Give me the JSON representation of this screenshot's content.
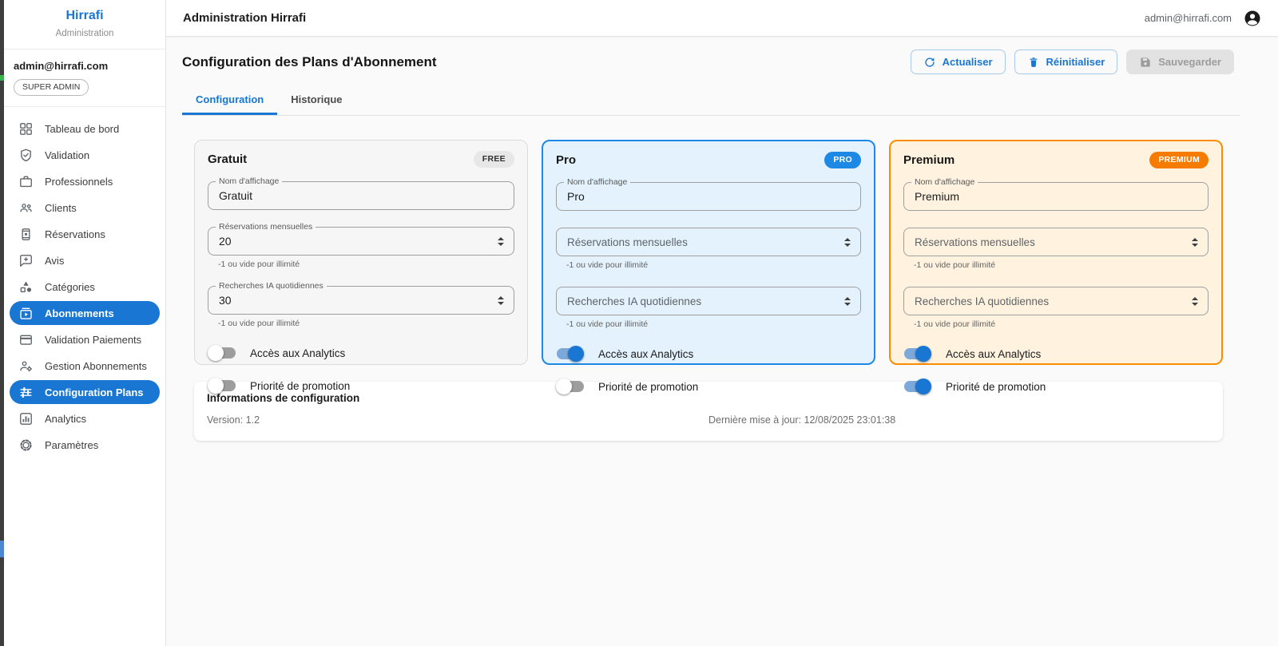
{
  "colors": {
    "accent": "#1976d2",
    "free_card_bg": "#f6f6f6",
    "free_card_border": "#dbdbdb",
    "free_badge_bg": "#e7e7e7",
    "free_badge_text": "#2f2f2f",
    "pro_card_bg": "#e3f2fd",
    "pro_card_border": "#1e88e5",
    "pro_badge_bg": "#1e88e5",
    "pro_badge_text": "#ffffff",
    "premium_card_bg": "#fff3e0",
    "premium_card_border": "#fb8c00",
    "premium_badge_bg": "#f57c00",
    "premium_badge_text": "#ffffff"
  },
  "sidebar": {
    "brand_title": "Hirrafi",
    "brand_subtitle": "Administration",
    "user_email": "admin@hirrafi.com",
    "user_role": "SUPER ADMIN",
    "items": [
      {
        "label": "Tableau de bord",
        "icon": "dashboard-icon",
        "selected": false
      },
      {
        "label": "Validation",
        "icon": "shield-check-icon",
        "selected": false
      },
      {
        "label": "Professionnels",
        "icon": "briefcase-icon",
        "selected": false
      },
      {
        "label": "Clients",
        "icon": "people-icon",
        "selected": false
      },
      {
        "label": "Réservations",
        "icon": "reservations-icon",
        "selected": false
      },
      {
        "label": "Avis",
        "icon": "review-icon",
        "selected": false
      },
      {
        "label": "Catégories",
        "icon": "categories-icon",
        "selected": false
      },
      {
        "label": "Abonnements",
        "icon": "subscriptions-icon",
        "selected": true
      },
      {
        "label": "Validation Paiements",
        "icon": "credit-card-icon",
        "selected": false
      },
      {
        "label": "Gestion Abonnements",
        "icon": "user-gear-icon",
        "selected": false
      },
      {
        "label": "Configuration Plans",
        "icon": "tune-icon",
        "selected": true
      },
      {
        "label": "Analytics",
        "icon": "analytics-icon",
        "selected": false
      },
      {
        "label": "Paramètres",
        "icon": "gear-icon",
        "selected": false
      }
    ]
  },
  "topbar": {
    "title": "Administration Hirrafi",
    "user_email": "admin@hirrafi.com"
  },
  "page": {
    "title": "Configuration des Plans d'Abonnement",
    "buttons": [
      {
        "name": "refresh",
        "label": "Actualiser",
        "icon": "refresh-icon",
        "style": "outlined"
      },
      {
        "name": "reset",
        "label": "Réinitialiser",
        "icon": "trash-icon",
        "style": "outlined"
      },
      {
        "name": "save",
        "label": "Sauvegarder",
        "icon": "save-icon",
        "style": "disabled"
      }
    ],
    "tabs": [
      {
        "label": "Configuration",
        "active": true
      },
      {
        "label": "Historique",
        "active": false
      }
    ]
  },
  "plan_fields": {
    "name_label": "Nom d'affichage",
    "reservations_label": "Réservations mensuelles",
    "searches_label": "Recherches IA quotidiennes",
    "unlimited_hint": "-1 ou vide pour illimité",
    "analytics_label": "Accès aux Analytics",
    "promotion_label": "Priorité de promotion"
  },
  "plans": [
    {
      "key": "free",
      "title": "Gratuit",
      "badge": "FREE",
      "name_value": "Gratuit",
      "reservations_value": "20",
      "searches_value": "30",
      "analytics_on": false,
      "promotion_on": false
    },
    {
      "key": "pro",
      "title": "Pro",
      "badge": "PRO",
      "name_value": "Pro",
      "reservations_value": "",
      "searches_value": "",
      "analytics_on": true,
      "promotion_on": false
    },
    {
      "key": "premium",
      "title": "Premium",
      "badge": "PREMIUM",
      "name_value": "Premium",
      "reservations_value": "",
      "searches_value": "",
      "analytics_on": true,
      "promotion_on": true
    }
  ],
  "info": {
    "title": "Informations de configuration",
    "version": "Version: 1.2",
    "last_update": "Dernière mise à jour: 12/08/2025 23:01:38"
  }
}
